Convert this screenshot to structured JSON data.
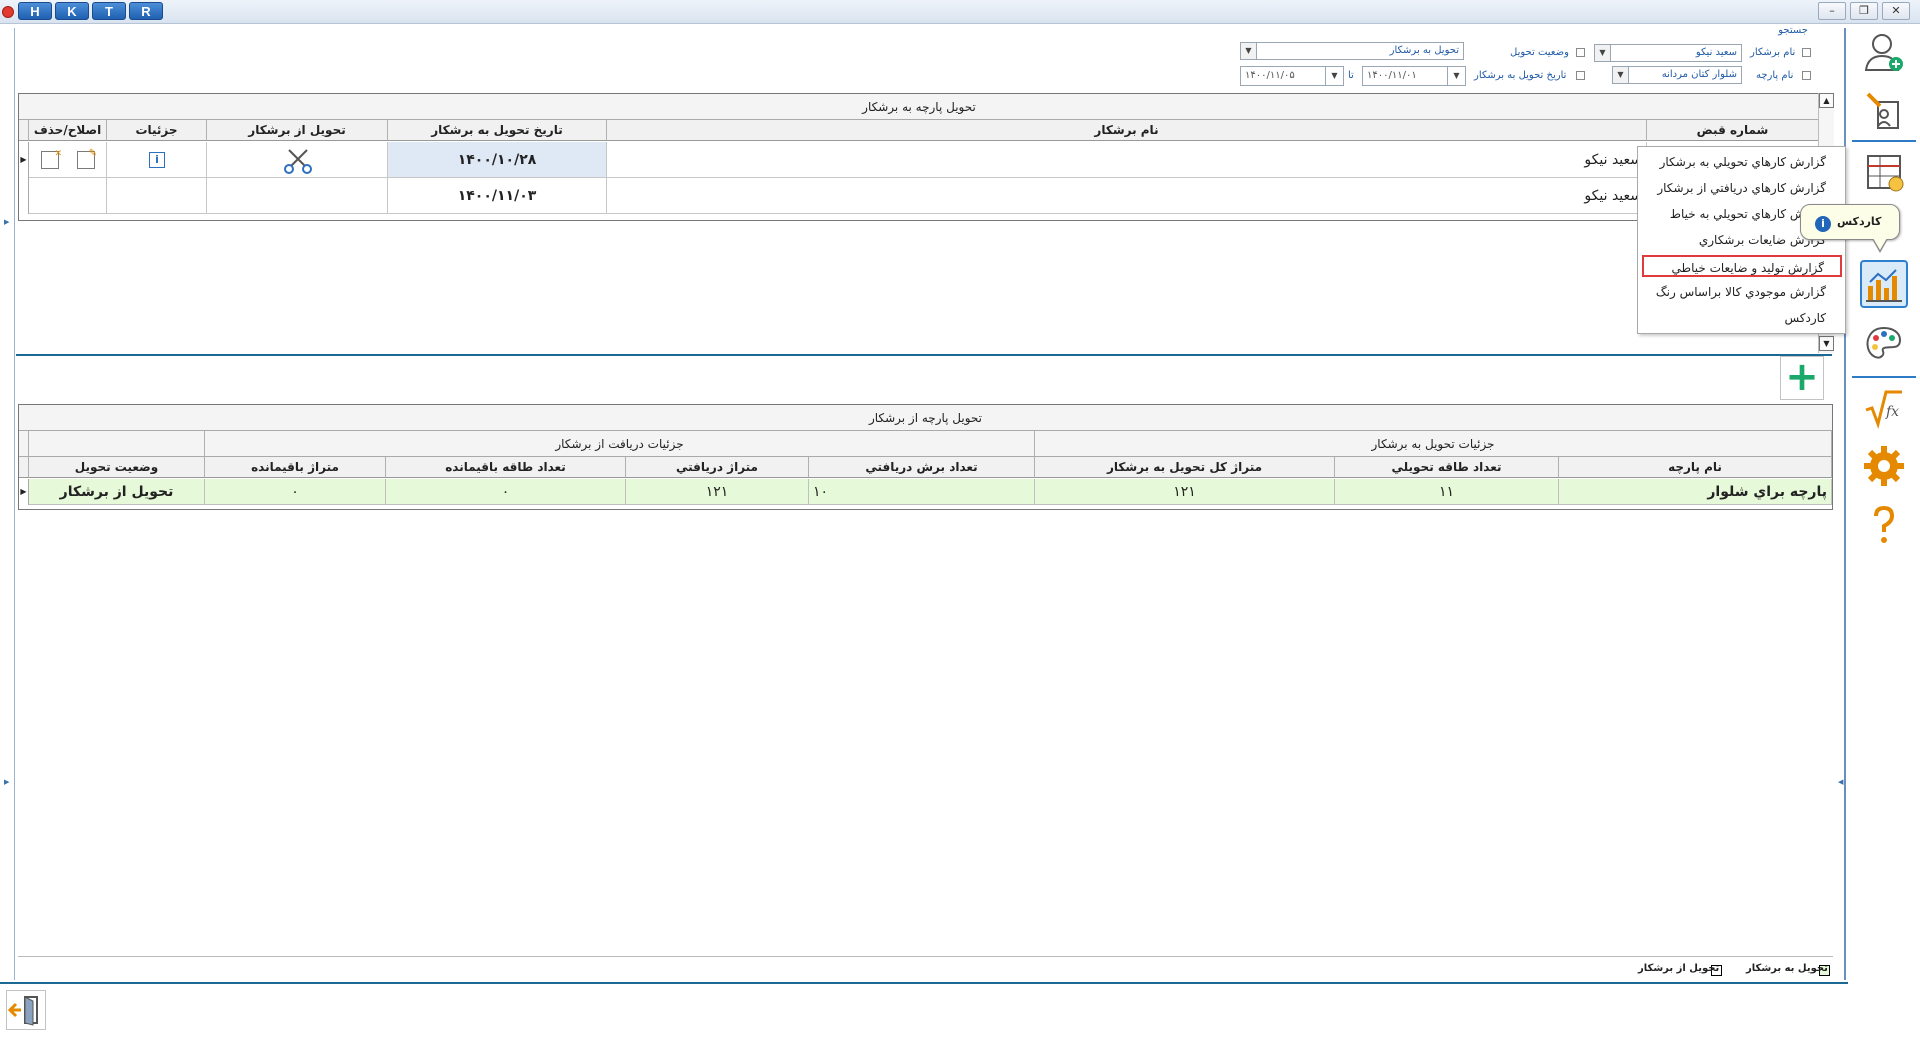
{
  "titlebar": {
    "quick_buttons": [
      "H",
      "K",
      "T",
      "R"
    ],
    "window_controls": [
      "–",
      "❐",
      "✕"
    ]
  },
  "search": {
    "legend": "جستجو",
    "contractor_label": "نام برشكار",
    "contractor_value": "سعيد نيكو",
    "fabric_label": "نام پارچه",
    "fabric_value": "شلوار كتان مردانه",
    "status_label": "وضعيت تحويل",
    "status_value": "تحويل به برشكار",
    "date_label": "تاريخ تحويل به برشكار",
    "date_from": "۱۴۰۰/۱۱/۰۱",
    "date_to_label": "تا",
    "date_to": "۱۴۰۰/۱۱/۰۵"
  },
  "grid1": {
    "caption": "تحويل پارچه به برشكار",
    "headers": {
      "receipt": "شماره قبض",
      "name": "نام برشكار",
      "date": "تاريخ تحويل به برشكار",
      "from": "تحويل از برشكار",
      "details": "جزئيات",
      "edit": "اصلاح/حذف"
    },
    "rows": [
      {
        "name": "سعيد نيكو",
        "date": "۱۴۰۰/۱۰/۲۸"
      },
      {
        "name": "سعيد نيكو",
        "date": "۱۴۰۰/۱۱/۰۳"
      }
    ]
  },
  "grid2": {
    "caption": "تحويل پارچه از برشكار",
    "band_delivery": "جزئيات تحويل به برشكار",
    "band_receive": "جزئيات دريافت از برشكار",
    "headers": {
      "fabric": "نام پارچه",
      "rolls": "تعداد طاقه تحويلي",
      "meters_total": "متراژ كل تحويل به برشكار",
      "cuts": "تعداد برش دريافتي",
      "meters_recv": "متراژ دريافتي",
      "rolls_left": "تعداد طاقه باقيمانده",
      "meters_left": "متراژ باقيمانده",
      "status": "وضعيت تحويل"
    },
    "rows": [
      {
        "fabric": "پارچه براي شلوار",
        "rolls": "۱۱",
        "meters_total": "۱۲۱",
        "cuts": "۱۰",
        "meters_recv": "۱۲۱",
        "rolls_left": "۰",
        "meters_left": "۰",
        "status": "تحويل از برشكار"
      }
    ]
  },
  "legend": {
    "to_contractor": "تحويل به برشكار",
    "from_contractor": "تحويل از برشكار",
    "to_color": "#e6f9d8",
    "from_color": "#ffffff"
  },
  "popup_menu": {
    "items": [
      "گزارش كارهاي تحويلي به برشكار",
      "گزارش كارهاي دريافتي از برشكار",
      "گزارش كارهاي تحويلي به خياط",
      "گزارش ضايعات برشكاري",
      "گزارش توليد و ضايعات خياطي",
      "گزارش موجودي كالا براساس رنگ",
      "كاردكس"
    ],
    "highlighted_index": 4,
    "highlight_color": "#e0393e"
  },
  "tooltip": {
    "label": "كاردكس"
  },
  "sidebar": {
    "icons": [
      "add-user-icon",
      "user-tools-icon",
      "spreadsheet-money-icon",
      "bar-chart-icon",
      "palette-icon",
      "sqrt-fx-icon",
      "gear-icon",
      "help-icon"
    ],
    "active": "bar-chart-icon"
  },
  "colors": {
    "accent": "#1c6a94",
    "selected_row": "#dfe9f6",
    "green_row": "#e6f9d8"
  }
}
